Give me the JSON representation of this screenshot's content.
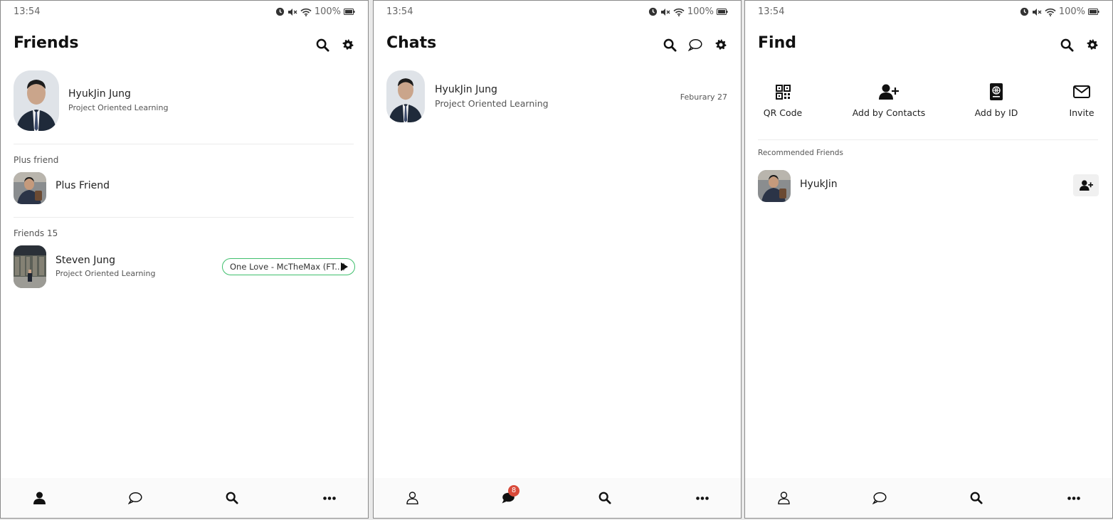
{
  "status": {
    "time": "13:54",
    "battery": "100%"
  },
  "friends_screen": {
    "title": "Friends",
    "profile": {
      "name": "HyukJin Jung",
      "status_message": "Project Oriented Learning"
    },
    "plus_section_label": "Plus friend",
    "plus_friend": {
      "name": "Plus Friend"
    },
    "friends_section_label": "Friends 15",
    "friends": [
      {
        "name": "Steven Jung",
        "status_message": "Project Oriented Learning",
        "music": "One Love - McTheMax (FT...)"
      }
    ]
  },
  "chats_screen": {
    "title": "Chats",
    "chats": [
      {
        "name": "HyukJin Jung",
        "preview": "Project Oriented Learning",
        "date": "Feburary 27"
      }
    ],
    "unread_badge": "8"
  },
  "find_screen": {
    "title": "Find",
    "options": [
      {
        "label": "QR Code",
        "icon": "qr-code-icon"
      },
      {
        "label": "Add by Contacts",
        "icon": "add-user-icon"
      },
      {
        "label": "Add by ID",
        "icon": "id-book-icon"
      },
      {
        "label": "Invite",
        "icon": "envelope-icon"
      }
    ],
    "recommended_label": "Recommended Friends",
    "recommended": [
      {
        "name": "HyukJin"
      }
    ]
  },
  "colors": {
    "accent_green": "#3fbf6d",
    "badge_red": "#d94a3a"
  }
}
